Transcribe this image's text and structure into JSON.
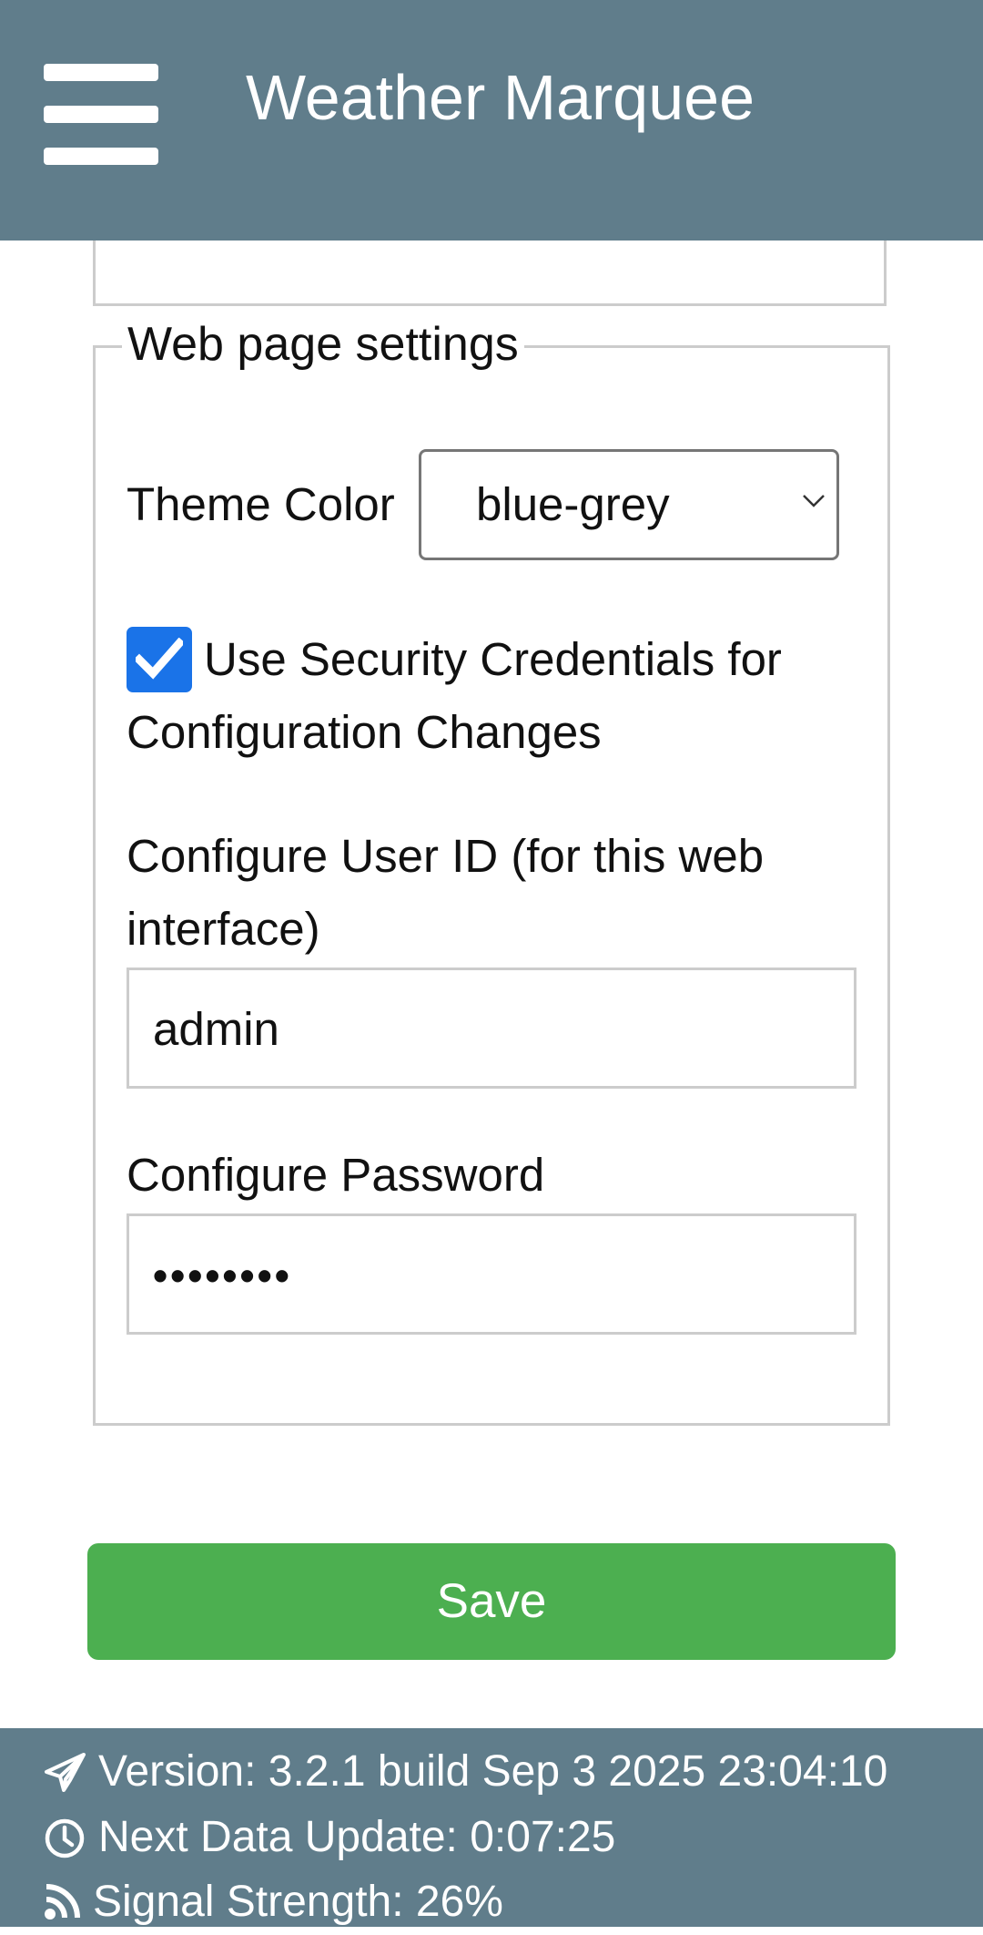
{
  "header": {
    "title": "Weather Marquee",
    "menu_icon": "hamburger-menu-icon"
  },
  "section": {
    "legend": "Web page settings"
  },
  "theme": {
    "label": "Theme Color",
    "selected": "blue-grey"
  },
  "security": {
    "checked": true,
    "label": "Use Security Credentials for Configuration Changes"
  },
  "user_id": {
    "label": "Configure User ID (for this web interface)",
    "value": "admin"
  },
  "password": {
    "label": "Configure Password",
    "masked_value": "••••••••"
  },
  "save": {
    "label": "Save"
  },
  "footer": {
    "version": "Version: 3.2.1 build Sep 3 2025 23:04:10",
    "next_update": "Next Data Update: 0:07:25",
    "signal": "Signal Strength: 26%"
  },
  "colors": {
    "header_bg": "#607d8b",
    "save_bg": "#4caf50",
    "checkbox_bg": "#1a73e8"
  }
}
